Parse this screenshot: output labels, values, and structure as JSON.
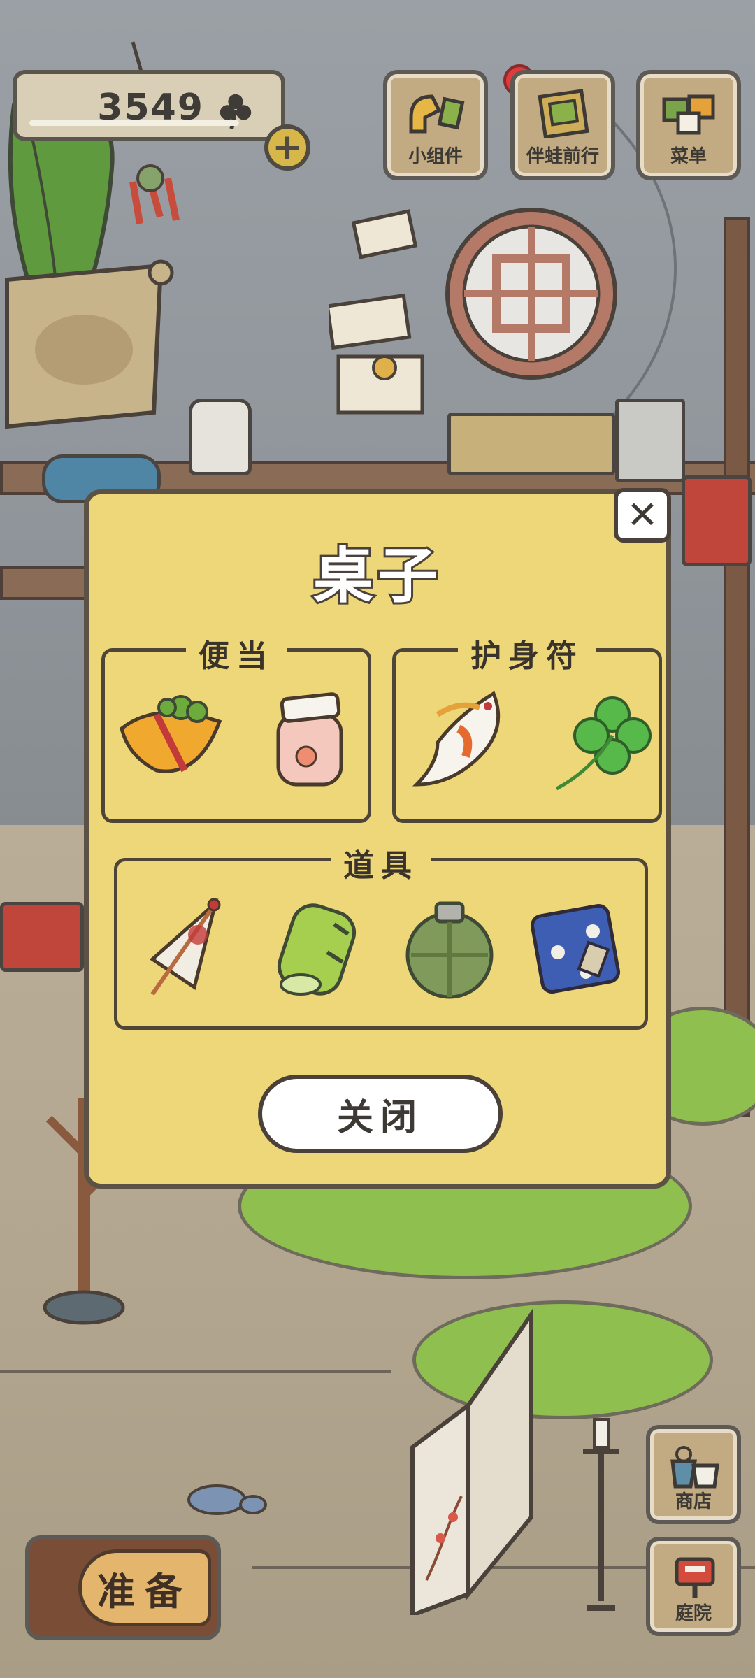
{
  "hud": {
    "clover_count": "3549",
    "add_label": "+",
    "top_buttons": {
      "widgets": "小组件",
      "travel_with_frog": "伴蛙前行",
      "menu": "菜单"
    },
    "side_buttons": {
      "shop": "商店",
      "garden": "庭院"
    },
    "prepare_label": "准备"
  },
  "modal": {
    "title": "桌子",
    "close_x": "✕",
    "groups": {
      "bento": {
        "label": "便当",
        "items": [
          "omelette-sandwich-icon",
          "peach-jar-icon"
        ]
      },
      "amulet": {
        "label": "护身符",
        "items": [
          "koi-charm-icon",
          "four-leaf-clover-icon"
        ]
      },
      "tools": {
        "label": "道具",
        "items": [
          "paper-umbrella-icon",
          "green-sleeping-roll-icon",
          "canteen-icon",
          "blue-bag-icon"
        ]
      }
    },
    "close_button": "关闭"
  },
  "colors": {
    "modal_bg": "#eed779",
    "outline": "#4a423a",
    "wall": "#9aa0a5",
    "floor": "#b4a892",
    "grass": "#8fbf4e",
    "clover_green": "#4caf50"
  }
}
